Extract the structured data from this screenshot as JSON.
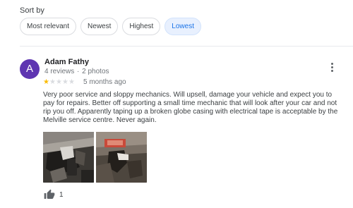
{
  "sort": {
    "label": "Sort by",
    "options": [
      {
        "label": "Most relevant",
        "active": false
      },
      {
        "label": "Newest",
        "active": false
      },
      {
        "label": "Highest",
        "active": false
      },
      {
        "label": "Lowest",
        "active": true
      }
    ]
  },
  "review": {
    "avatar_letter": "A",
    "avatar_color": "#5e35b1",
    "author": "Adam Fathy",
    "reviews_count": "4 reviews",
    "separator": "·",
    "photos_count": "2 photos",
    "rating": 1,
    "rating_max": 5,
    "time": "5 months ago",
    "text": "Very poor service and sloppy mechanics. Will upsell, damage your vehicle and expect you to pay for repairs. Better off supporting a small time mechanic that will look after your car and not rip you off. Apparently taping up a broken globe casing with electrical tape is acceptable by the Melville service centre. Never again.",
    "photos": [
      {
        "icon": "car-headlight-photo"
      },
      {
        "icon": "car-interior-light-photo"
      }
    ],
    "likes": "1",
    "more_icon": "more-vert-icon",
    "like_icon": "thumbs-up-icon"
  },
  "colors": {
    "star_filled": "#fbbc04",
    "star_empty": "#dadce0",
    "active_chip_bg": "#e8f0fe",
    "active_chip_text": "#1a73e8"
  }
}
